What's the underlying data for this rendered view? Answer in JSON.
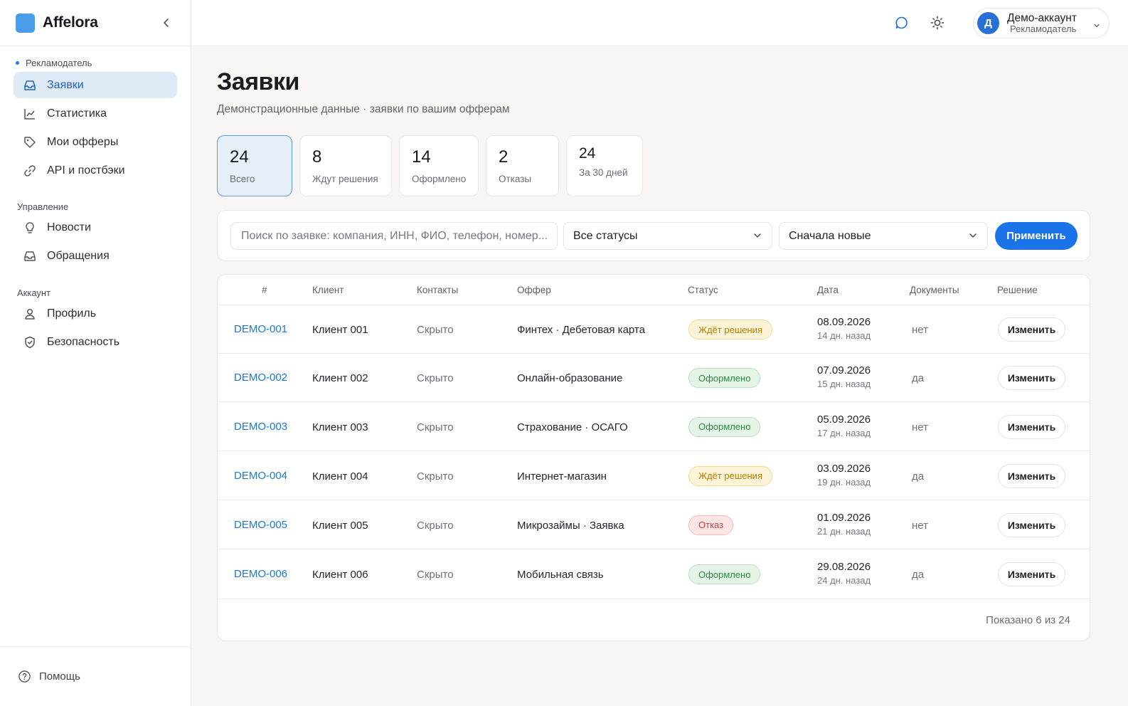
{
  "brand": {
    "name": "Affelora"
  },
  "sidebar": {
    "role": "Рекламодатель",
    "items": [
      {
        "label": "Заявки"
      },
      {
        "label": "Статистика"
      },
      {
        "label": "Мои офферы"
      },
      {
        "label": "API и постбэки"
      }
    ],
    "sections": {
      "manage": {
        "title": "Управление",
        "items": [
          {
            "label": "Новости"
          },
          {
            "label": "Обращения"
          }
        ]
      },
      "account": {
        "title": "Аккаунт",
        "items": [
          {
            "label": "Профиль"
          },
          {
            "label": "Безопасность"
          }
        ]
      }
    },
    "help": "Помощь"
  },
  "topbar": {
    "account": {
      "initial": "Д",
      "name": "Демо-аккаунт",
      "role": "Рекламодатель"
    }
  },
  "page": {
    "title": "Заявки",
    "subtitle": "Демонстрационные данные · заявки по вашим офферам"
  },
  "stats": [
    {
      "value": "24",
      "label": "Всего"
    },
    {
      "value": "8",
      "label": "Ждут решения"
    },
    {
      "value": "14",
      "label": "Оформлено"
    },
    {
      "value": "2",
      "label": "Отказы"
    },
    {
      "value": "24",
      "label": "За 30 дней"
    }
  ],
  "filters": {
    "search_placeholder": "Поиск по заявке: компания, ИНН, ФИО, телефон, номер...",
    "status": "Все статусы",
    "sort": "Сначала новые",
    "apply": "Применить"
  },
  "table": {
    "columns": [
      "#",
      "Клиент",
      "Контакты",
      "Оффер",
      "Статус",
      "Дата",
      "Документы",
      "Решение"
    ],
    "rows": [
      {
        "id": "DEMO-001",
        "client": "Клиент 001",
        "contacts": "Скрыто",
        "offer": "Финтех · Дебетовая карта",
        "status": "Ждёт решения",
        "status_type": "wait",
        "date": "08.09.2026",
        "ago": "14 дн. назад",
        "docs": "нет",
        "action": "Изменить"
      },
      {
        "id": "DEMO-002",
        "client": "Клиент 002",
        "contacts": "Скрыто",
        "offer": "Онлайн-образование",
        "status": "Оформлено",
        "status_type": "done",
        "date": "07.09.2026",
        "ago": "15 дн. назад",
        "docs": "да",
        "action": "Изменить"
      },
      {
        "id": "DEMO-003",
        "client": "Клиент 003",
        "contacts": "Скрыто",
        "offer": "Страхование · ОСАГО",
        "status": "Оформлено",
        "status_type": "done",
        "date": "05.09.2026",
        "ago": "17 дн. назад",
        "docs": "нет",
        "action": "Изменить"
      },
      {
        "id": "DEMO-004",
        "client": "Клиент 004",
        "contacts": "Скрыто",
        "offer": "Интернет-магазин",
        "status": "Ждёт решения",
        "status_type": "wait",
        "date": "03.09.2026",
        "ago": "19 дн. назад",
        "docs": "да",
        "action": "Изменить"
      },
      {
        "id": "DEMO-005",
        "client": "Клиент 005",
        "contacts": "Скрыто",
        "offer": "Микрозаймы · Заявка",
        "status": "Отказ",
        "status_type": "reject",
        "date": "01.09.2026",
        "ago": "21 дн. назад",
        "docs": "нет",
        "action": "Изменить"
      },
      {
        "id": "DEMO-006",
        "client": "Клиент 006",
        "contacts": "Скрыто",
        "offer": "Мобильная связь",
        "status": "Оформлено",
        "status_type": "done",
        "date": "29.08.2026",
        "ago": "24 дн. назад",
        "docs": "да",
        "action": "Изменить"
      }
    ],
    "footer": "Показано 6 из 24"
  },
  "colors": {
    "accent": "#1a73e8",
    "link": "#1f78c9",
    "active_nav_bg": "#dfeaf7"
  }
}
